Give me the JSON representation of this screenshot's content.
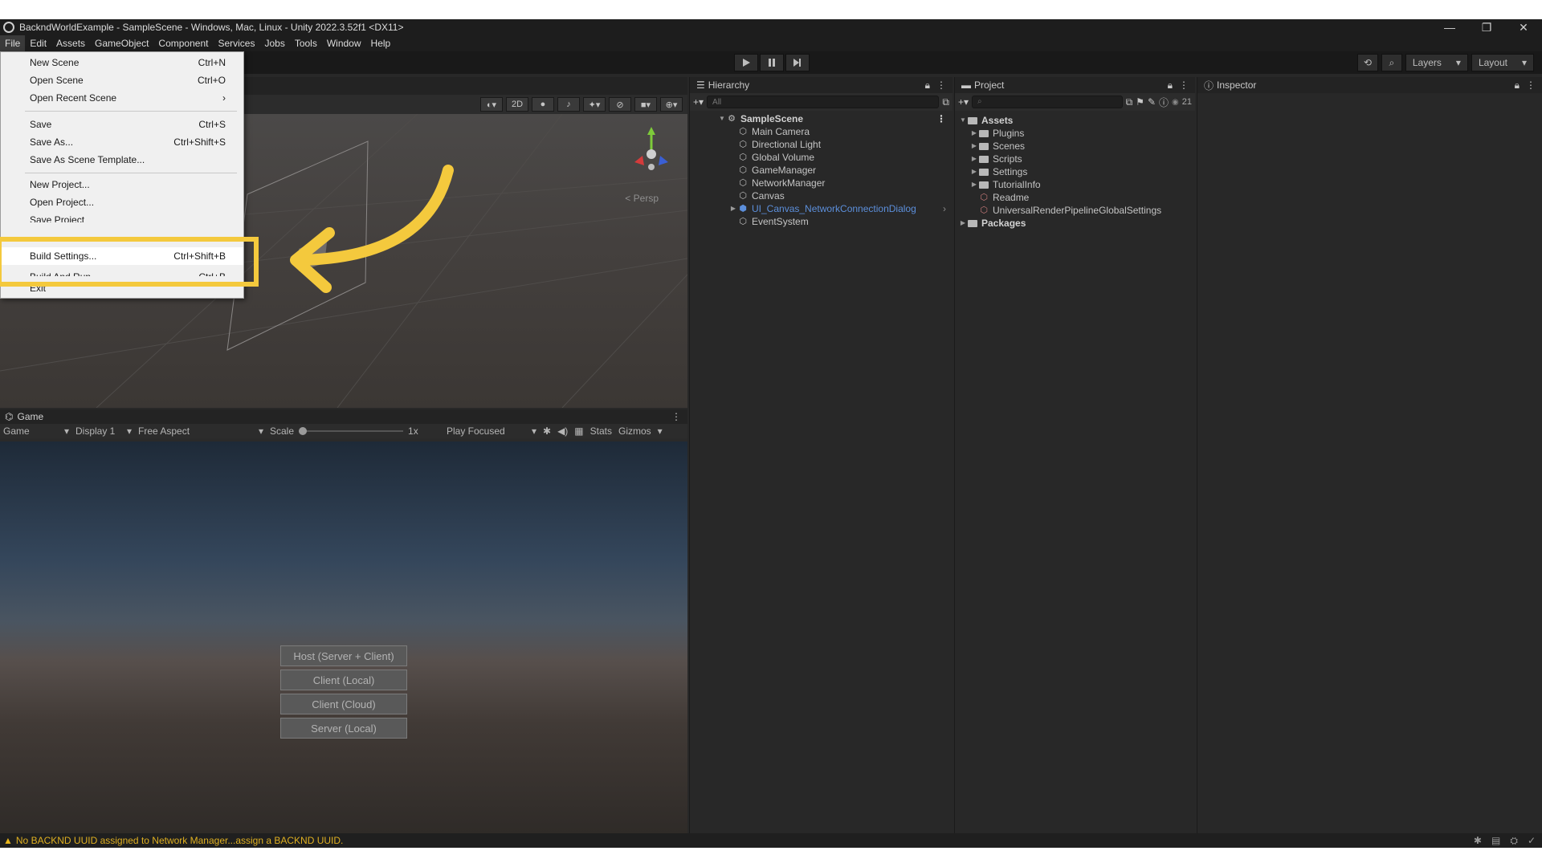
{
  "window": {
    "title": "BackndWorldExample - SampleScene - Windows, Mac, Linux - Unity 2022.3.52f1 <DX11>",
    "controls": [
      "—",
      "❐",
      "✕"
    ]
  },
  "menubar": [
    "File",
    "Edit",
    "Assets",
    "GameObject",
    "Component",
    "Services",
    "Jobs",
    "Tools",
    "Window",
    "Help"
  ],
  "file_menu": {
    "items": [
      {
        "label": "New Scene",
        "shortcut": "Ctrl+N"
      },
      {
        "label": "Open Scene",
        "shortcut": "Ctrl+O"
      },
      {
        "label": "Open Recent Scene",
        "shortcut": "›"
      },
      {
        "label": "Save",
        "shortcut": "Ctrl+S"
      },
      {
        "label": "Save As...",
        "shortcut": "Ctrl+Shift+S"
      },
      {
        "label": "Save As Scene Template...",
        "shortcut": ""
      },
      {
        "label": "New Project...",
        "shortcut": ""
      },
      {
        "label": "Open Project...",
        "shortcut": ""
      },
      {
        "label": "Save Project",
        "shortcut": ""
      },
      {
        "label": "Build Settings...",
        "shortcut": "Ctrl+Shift+B"
      },
      {
        "label": "Build And Run",
        "shortcut": "Ctrl+B"
      },
      {
        "label": "Exit",
        "shortcut": ""
      }
    ]
  },
  "toolbar": {
    "layers_label": "Layers",
    "layout_label": "Layout"
  },
  "scene": {
    "mode_2d": "2D",
    "persp_label": "< Persp"
  },
  "game": {
    "tab_label": "Game",
    "mode": "Game",
    "display": "Display 1",
    "aspect": "Free Aspect",
    "scale_label": "Scale",
    "scale_value": "1x",
    "play_focus": "Play Focused",
    "stats": "Stats",
    "gizmos": "Gizmos",
    "buttons": [
      "Host (Server + Client)",
      "Client (Local)",
      "Client (Cloud)",
      "Server (Local)"
    ]
  },
  "hierarchy": {
    "tab_label": "Hierarchy",
    "search_placeholder": "All",
    "scene_name": "SampleScene",
    "items": [
      "Main Camera",
      "Directional Light",
      "Global Volume",
      "GameManager",
      "NetworkManager",
      "Canvas",
      "UI_Canvas_NetworkConnectionDialog",
      "EventSystem"
    ]
  },
  "project": {
    "tab_label": "Project",
    "badge_count": "21",
    "root": "Assets",
    "folders": [
      "Plugins",
      "Scenes",
      "Scripts",
      "Settings",
      "TutorialInfo"
    ],
    "files": [
      "Readme",
      "UniversalRenderPipelineGlobalSettings"
    ],
    "packages": "Packages"
  },
  "inspector": {
    "tab_label": "Inspector"
  },
  "status": {
    "message": "No BACKND UUID assigned to Network Manager...assign a BACKND UUID."
  },
  "colors": {
    "highlight": "#f4c93d",
    "prefab_blue": "#5c8fdb",
    "warning": "#e0b020"
  }
}
